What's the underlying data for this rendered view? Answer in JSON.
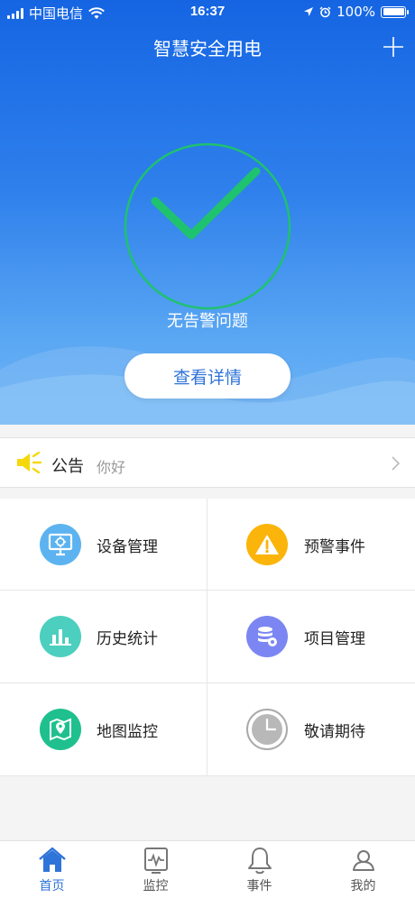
{
  "status_bar": {
    "carrier": "中国电信",
    "time": "16:37",
    "battery": "100%",
    "battery_level": 1.0
  },
  "header": {
    "title": "智慧安全用电",
    "add_icon": "plus-icon"
  },
  "hero": {
    "status_icon": "checkmark-icon",
    "status_text": "无告警问题",
    "details_button": "查看详情"
  },
  "notice": {
    "icon": "megaphone-icon",
    "title": "公告",
    "text": "你好",
    "arrow_icon": "chevron-right-icon"
  },
  "menu": [
    {
      "label": "设备管理",
      "icon": "device-monitor-icon",
      "color": "#5cb3f0"
    },
    {
      "label": "预警事件",
      "icon": "warning-icon",
      "color": "#fbb40a"
    },
    {
      "label": "历史统计",
      "icon": "bar-chart-icon",
      "color": "#4ccfbe"
    },
    {
      "label": "项目管理",
      "icon": "database-gear-icon",
      "color": "#7c86f2"
    },
    {
      "label": "地图监控",
      "icon": "map-pin-icon",
      "color": "#1fc08e"
    },
    {
      "label": "敬请期待",
      "icon": "clock-icon",
      "color": "#b8b8b8"
    }
  ],
  "tabbar": [
    {
      "label": "首页",
      "icon": "home-icon",
      "active": true
    },
    {
      "label": "监控",
      "icon": "monitor-pulse-icon",
      "active": false
    },
    {
      "label": "事件",
      "icon": "bell-icon",
      "active": false
    },
    {
      "label": "我的",
      "icon": "user-icon",
      "active": false
    }
  ],
  "colors": {
    "primary": "#2f74d8",
    "hero_top": "#1565e3",
    "hero_bottom": "#6fb5f5",
    "check_green": "#1fc26e",
    "notice_yellow": "#f5d80a"
  }
}
